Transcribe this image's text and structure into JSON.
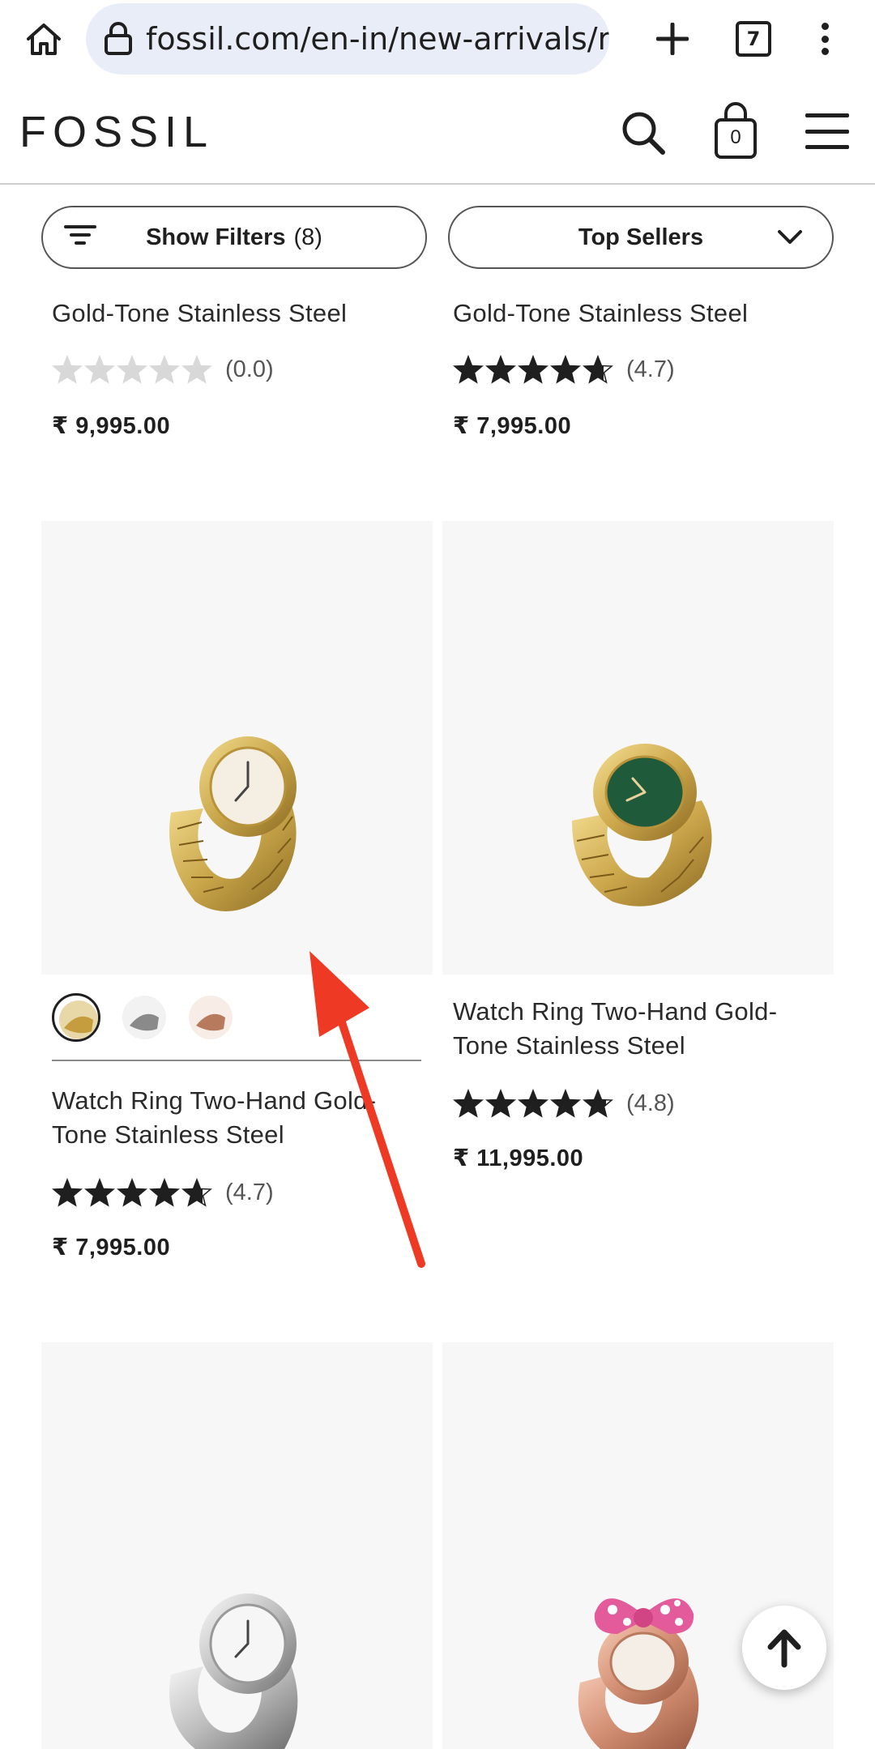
{
  "browser": {
    "url": "fossil.com/en-in/new-arrivals/r",
    "tab_count": "7",
    "icons": [
      "home-icon",
      "lock-icon",
      "plus-icon",
      "tab-switcher-icon",
      "more-vert-icon"
    ]
  },
  "header": {
    "logo": "FOSSIL",
    "cart_count": "0",
    "icons": [
      "search-icon",
      "shopping-bag-icon",
      "hamburger-menu-icon"
    ]
  },
  "toolbar": {
    "filter_label": "Show Filters",
    "filter_count": "(8)",
    "sort_label": "Top Sellers"
  },
  "products": [
    {
      "name": "Gold-Tone Stainless Steel",
      "rating": "(0.0)",
      "rating_value": 0.0,
      "price": "₹ 9,995.00"
    },
    {
      "name": "Gold-Tone Stainless Steel",
      "rating": "(4.7)",
      "rating_value": 4.7,
      "price": "₹ 7,995.00"
    },
    {
      "name": "Watch Ring Two-Hand Gold-Tone Stainless Steel",
      "rating": "(4.7)",
      "rating_value": 4.7,
      "price": "₹ 7,995.00",
      "swatches": [
        "gold",
        "silver",
        "rose-gold"
      ],
      "selected_swatch": 0
    },
    {
      "name": "Watch Ring Two-Hand Gold-Tone Stainless Steel",
      "rating": "(4.8)",
      "rating_value": 4.8,
      "price": "₹ 11,995.00"
    },
    {
      "name": "",
      "image": "silver-watch-ring"
    },
    {
      "name": "",
      "image": "rose-gold-minnie-watch-ring"
    }
  ],
  "colors": {
    "url_pill": "#e9edf8",
    "text": "#1f1f1f",
    "gold": "#c9a64a",
    "green_dial": "#1f5a3a",
    "annotation_arrow": "#ee3a24"
  }
}
